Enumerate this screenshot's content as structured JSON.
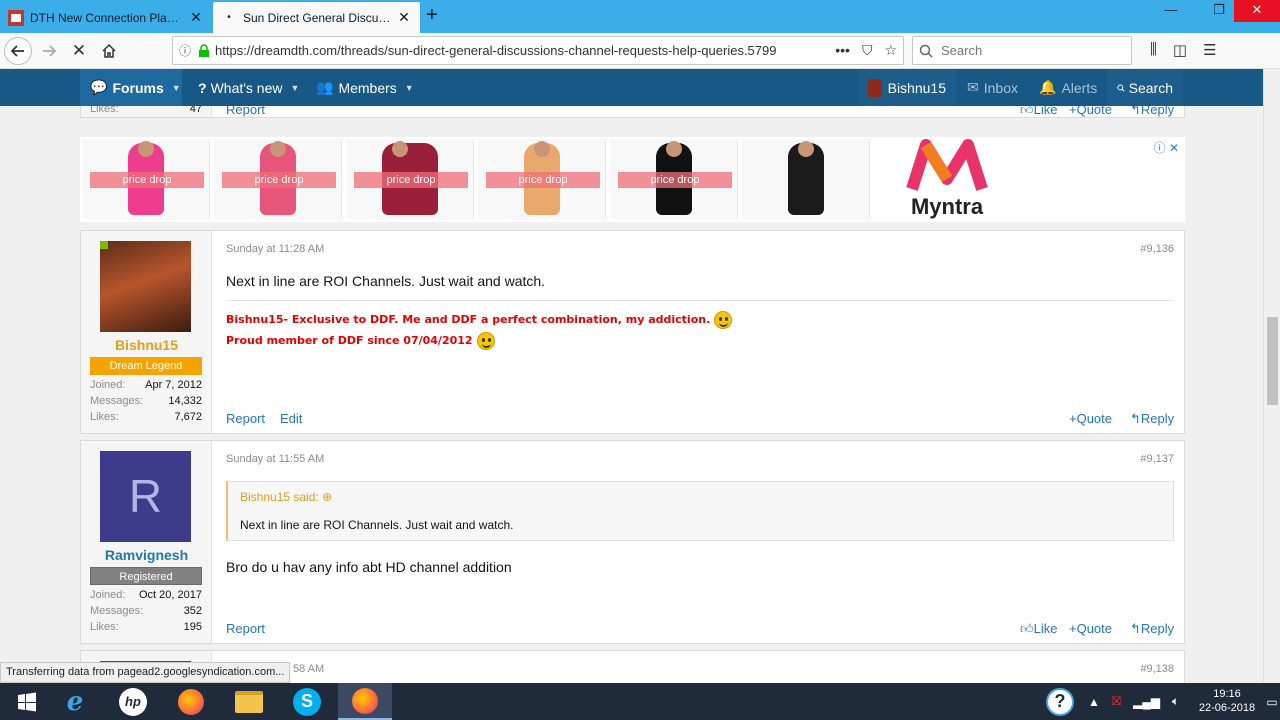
{
  "browser": {
    "tabs": [
      {
        "label": "DTH New Connection Plan | Su",
        "close": "✕"
      },
      {
        "label": "Sun Direct General Discussions",
        "close": "✕"
      }
    ],
    "new_tab": "+",
    "url": "https://dreamdth.com/threads/sun-direct-general-discussions-channel-requests-help-queries.5799",
    "search_placeholder": "Search",
    "status": "Transferring data from pagead2.googlesyndication.com..."
  },
  "sitenav": {
    "forums": "Forums",
    "whats_new": "What's new",
    "members": "Members",
    "user": "Bishnu15",
    "inbox": "Inbox",
    "alerts": "Alerts",
    "search": "Search"
  },
  "prev_post": {
    "likes_label": "Likes:",
    "likes_value": "47",
    "report": "Report",
    "like": "Like",
    "quote": "Quote",
    "reply": "Reply"
  },
  "ad": {
    "price_drop": "price drop",
    "brand": "Myntra"
  },
  "posts": [
    {
      "username": "Bishnu15",
      "badge": "Dream Legend",
      "joined_label": "Joined:",
      "joined": "Apr 7, 2012",
      "messages_label": "Messages:",
      "messages": "14,332",
      "likes_label": "Likes:",
      "likes": "7,672",
      "date": "Sunday at 11:28 AM",
      "number": "#9,136",
      "body": "Next in line are ROI Channels. Just wait and watch.",
      "sig1": "Bishnu15- Exclusive to DDF. Me and DDF a perfect combination, my addiction.",
      "sig2": "Proud member of DDF since 07/04/2012",
      "report": "Report",
      "edit": "Edit",
      "quote": "Quote",
      "reply": "Reply"
    },
    {
      "username": "Ramvignesh",
      "avatar_letter": "R",
      "badge": "Registered",
      "joined_label": "Joined:",
      "joined": "Oct 20, 2017",
      "messages_label": "Messages:",
      "messages": "352",
      "likes_label": "Likes:",
      "likes": "195",
      "date": "Sunday at 11:55 AM",
      "number": "#9,137",
      "quote_author": "Bishnu15 said:",
      "quote_text": "Next in line are ROI Channels. Just wait and watch.",
      "body": "Bro do u hav any info abt HD channel addition",
      "report": "Report",
      "like": "Like",
      "quote": "Quote",
      "reply": "Reply"
    }
  ],
  "next_post": {
    "date_fragment": "58 AM",
    "number": "#9,138"
  },
  "taskbar": {
    "time": "19:16",
    "date": "22-06-2018"
  },
  "colors": {
    "tab_bar": "#3baeea",
    "site_nav": "#185886",
    "link": "#2577b1",
    "signature": "#e50000",
    "badge_legend": "#f5a300",
    "badge_registered": "#828282",
    "username_legend": "#e69d18",
    "username_registered": "#2577b1"
  }
}
